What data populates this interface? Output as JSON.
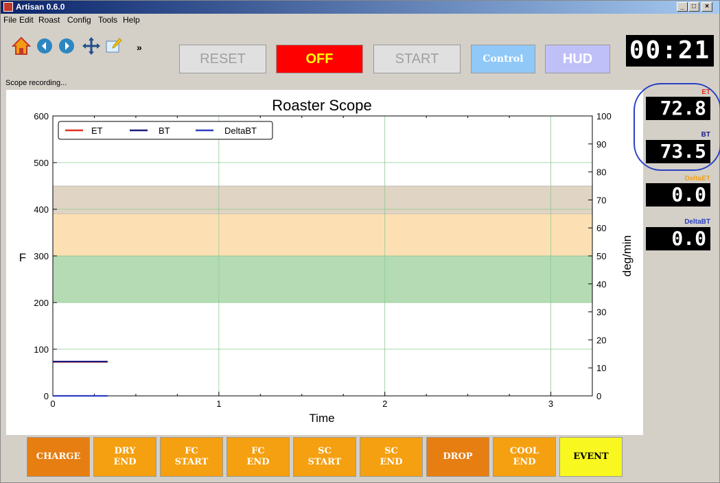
{
  "window": {
    "title": "Artisan 0.6.0",
    "controls": [
      "_",
      "□",
      "×"
    ]
  },
  "menu": [
    "File",
    "Edit",
    "Roast",
    "Config",
    "Tools",
    "Help"
  ],
  "toolbar": {
    "icons": [
      "home-icon",
      "back-icon",
      "forward-icon",
      "pan-icon",
      "edit-icon"
    ],
    "more": "»",
    "reset": "RESET",
    "off": "OFF",
    "start": "START",
    "control": "Control",
    "hud": "HUD",
    "timer": "00:21"
  },
  "status": "Scope recording...",
  "plot": {
    "title": "Roaster Scope",
    "xlabel": "Time",
    "ylabel_left": "F",
    "ylabel_right": "deg/min",
    "legend": [
      "ET",
      "BT",
      "DeltaBT"
    ]
  },
  "chart_data": {
    "type": "line",
    "title": "Roaster Scope",
    "xlabel": "Time",
    "ylabel": "F",
    "y2label": "deg/min",
    "xlim": [
      0,
      3.25
    ],
    "ylim": [
      0,
      600
    ],
    "y2lim": [
      0,
      100
    ],
    "xticks": [
      0,
      1,
      2,
      3
    ],
    "yticks": [
      0,
      100,
      200,
      300,
      400,
      500,
      600
    ],
    "y2ticks": [
      0,
      10,
      20,
      30,
      40,
      50,
      60,
      70,
      80,
      90,
      100
    ],
    "bands": [
      {
        "from": 200,
        "to": 300,
        "color": "#b4dbb4"
      },
      {
        "from": 300,
        "to": 390,
        "color": "#fce0b4"
      },
      {
        "from": 390,
        "to": 450,
        "color": "#e0d4c4"
      }
    ],
    "series": [
      {
        "name": "ET",
        "color": "#e03020",
        "x": [
          0,
          0.33
        ],
        "values": [
          72.8,
          72.8
        ]
      },
      {
        "name": "BT",
        "color": "#1a1a80",
        "x": [
          0,
          0.33
        ],
        "values": [
          73.5,
          73.5
        ]
      },
      {
        "name": "DeltaBT",
        "color": "#2a3fc0",
        "x": [
          0,
          0.33
        ],
        "values": [
          0,
          0
        ]
      }
    ],
    "grid": true,
    "legend_position": "top-left"
  },
  "readouts": {
    "et": {
      "label": "ET",
      "value": "72.8",
      "color": "#e03020"
    },
    "bt": {
      "label": "BT",
      "value": "73.5",
      "color": "#1a1a80"
    },
    "delta_et": {
      "label": "DeltaET",
      "value": "0.0",
      "color": "#f0a020"
    },
    "delta_bt": {
      "label": "DeltaBT",
      "value": "0.0",
      "color": "#2a3fc0"
    }
  },
  "events": [
    {
      "label": "CHARGE",
      "color": "#e67e12"
    },
    {
      "label": "DRY\nEND",
      "color": "#f5a010"
    },
    {
      "label": "FC\nSTART",
      "color": "#f5a010"
    },
    {
      "label": "FC\nEND",
      "color": "#f5a010"
    },
    {
      "label": "SC\nSTART",
      "color": "#f5a010"
    },
    {
      "label": "SC\nEND",
      "color": "#f5a010"
    },
    {
      "label": "DROP",
      "color": "#e67e12"
    },
    {
      "label": "COOL\nEND",
      "color": "#f5a010"
    },
    {
      "label": "EVENT",
      "color": "#f8f820"
    }
  ]
}
